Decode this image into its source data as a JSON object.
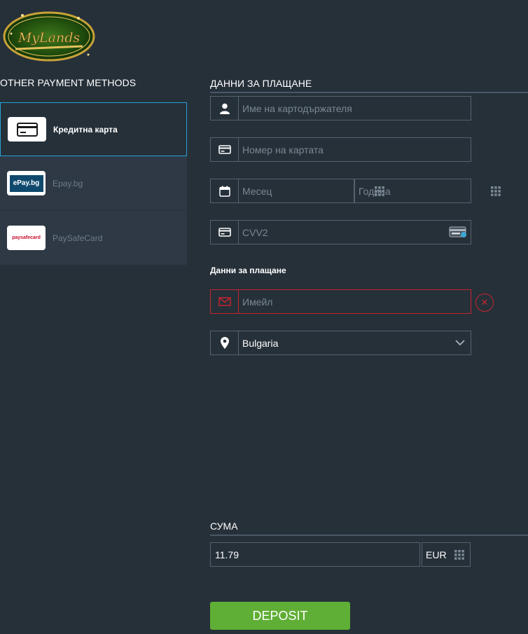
{
  "brand": {
    "logo_text": "MyLands"
  },
  "left": {
    "title": "OTHER PAYMENT METHODS",
    "methods": [
      {
        "label": "Кредитна карта",
        "badge": "card-icon",
        "active": true
      },
      {
        "label": "Epay.bg",
        "badge": "ePay.bg",
        "active": false
      },
      {
        "label": "PaySafeCard",
        "badge": "paysafecard",
        "active": false
      }
    ]
  },
  "payment": {
    "title": "ДАННИ ЗА ПЛАЩАНЕ",
    "cardholder_placeholder": "Име на картодържателя",
    "card_number_placeholder": "Номер на картата",
    "month_placeholder": "Месец",
    "year_placeholder": "Година",
    "cvv_placeholder": "CVV2",
    "billing_label": "Данни за плащане",
    "email_placeholder": "Имейл",
    "country_value": "Bulgaria"
  },
  "amount": {
    "title": "СУМА",
    "value": "11.79",
    "currency": "EUR"
  },
  "deposit_label": "DEPOSIT",
  "colors": {
    "background": "#263039",
    "accent_border": "#25a2d8",
    "error": "#c4262e",
    "deposit": "#5fae35"
  }
}
